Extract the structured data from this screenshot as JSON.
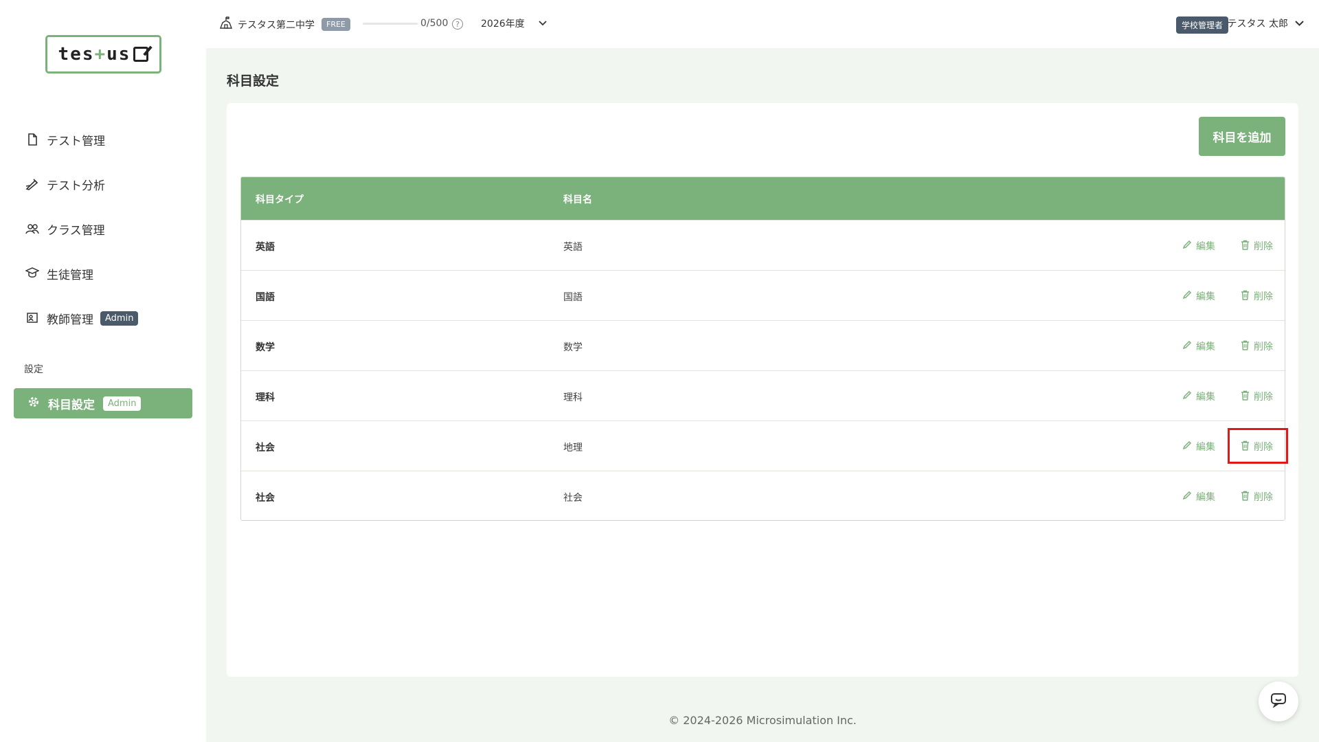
{
  "logo": {
    "left": "tes",
    "plus": "+",
    "right": "us"
  },
  "sidebar": {
    "items": [
      {
        "label": "テスト管理"
      },
      {
        "label": "テスト分析"
      },
      {
        "label": "クラス管理"
      },
      {
        "label": "生徒管理"
      },
      {
        "label": "教師管理",
        "badge": "Admin"
      }
    ],
    "section_label": "設定",
    "active": {
      "label": "科目設定",
      "badge": "Admin"
    }
  },
  "header": {
    "school_name": "テスタス第二中学",
    "plan_badge": "FREE",
    "usage_count": "0/500",
    "usage_fraction": 0,
    "year": "2026年度",
    "role_badge": "学校管理者",
    "user_name": "テスタス 太郎"
  },
  "main": {
    "page_title": "科目設定",
    "add_button": "科目を追加",
    "table": {
      "headers": [
        "科目タイプ",
        "科目名"
      ],
      "edit_label": "編集",
      "delete_label": "削除",
      "rows": [
        {
          "type": "英語",
          "name": "英語"
        },
        {
          "type": "国語",
          "name": "国語"
        },
        {
          "type": "数学",
          "name": "数学"
        },
        {
          "type": "理科",
          "name": "理科"
        },
        {
          "type": "社会",
          "name": "地理"
        },
        {
          "type": "社会",
          "name": "社会"
        }
      ]
    }
  },
  "footer": {
    "copyright": "© 2024-2026 Microsimulation Inc."
  },
  "colors": {
    "accent": "#7bb17a",
    "highlight": "#e01818",
    "admin_badge": "#4a5a6a"
  }
}
